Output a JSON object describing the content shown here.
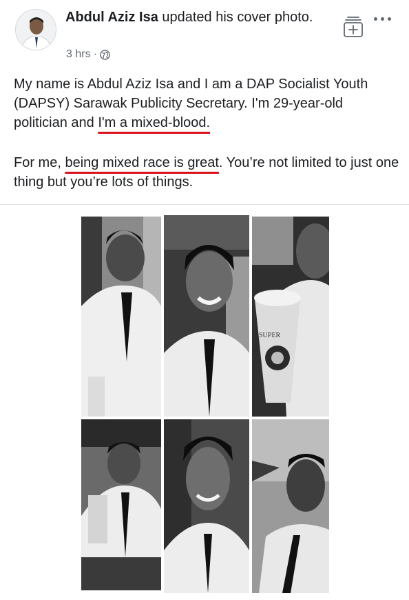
{
  "post": {
    "author": "Abdul Aziz Isa",
    "action": " updated his cover photo.",
    "time": "3 hrs",
    "separator": "·",
    "privacy_icon": "globe-icon",
    "save_icon": "save-post-icon",
    "more_icon": "more-options-icon",
    "paragraph1": {
      "before": "My name is Abdul Aziz Isa and I am a DAP Socialist Youth (DAPSY) Sarawak Publicity Secretary. I'm 29-year-old politician and ",
      "highlight": "I'm a mixed-blood.",
      "after": ""
    },
    "paragraph2": {
      "before": "For me, ",
      "highlight": "being mixed race is great",
      "after": ". You’re not limited to just one thing but you’re lots of things."
    },
    "cup_text": "SUPER",
    "highlight_color": "#d9111b",
    "photos": [
      "photo-1",
      "photo-2",
      "photo-3",
      "photo-4",
      "photo-5",
      "photo-6"
    ]
  }
}
